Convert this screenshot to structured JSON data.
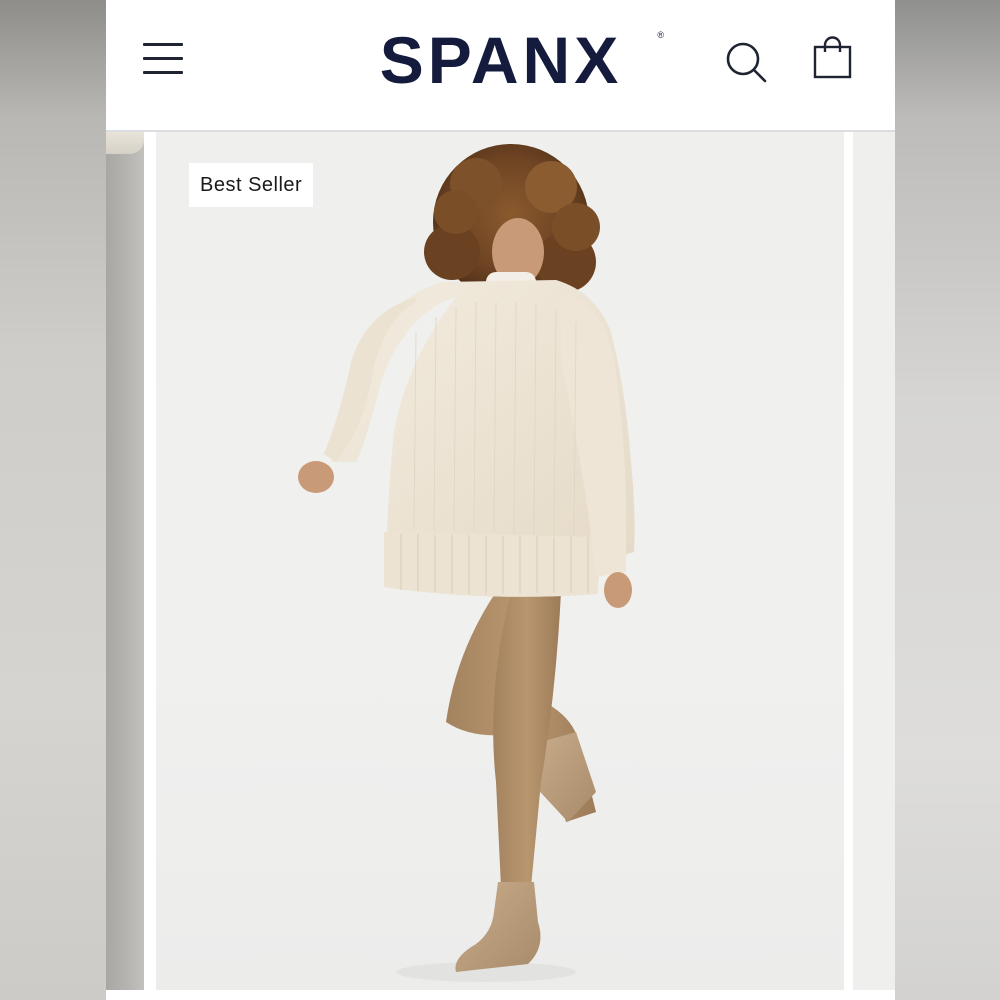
{
  "header": {
    "logo_text": "SPANX",
    "logo_mark": "®",
    "menu_icon": "hamburger-menu-icon",
    "search_icon": "search-icon",
    "bag_icon": "shopping-bag-icon"
  },
  "product": {
    "badge": "Best Seller",
    "image": "model-in-cream-sweater-and-suede-leggings"
  },
  "colors": {
    "brand_navy": "#141b3d",
    "header_bg": "#ffffff",
    "image_bg": "#efefee",
    "sweater": "#efe6d6",
    "leggings": "#b08f6d"
  }
}
